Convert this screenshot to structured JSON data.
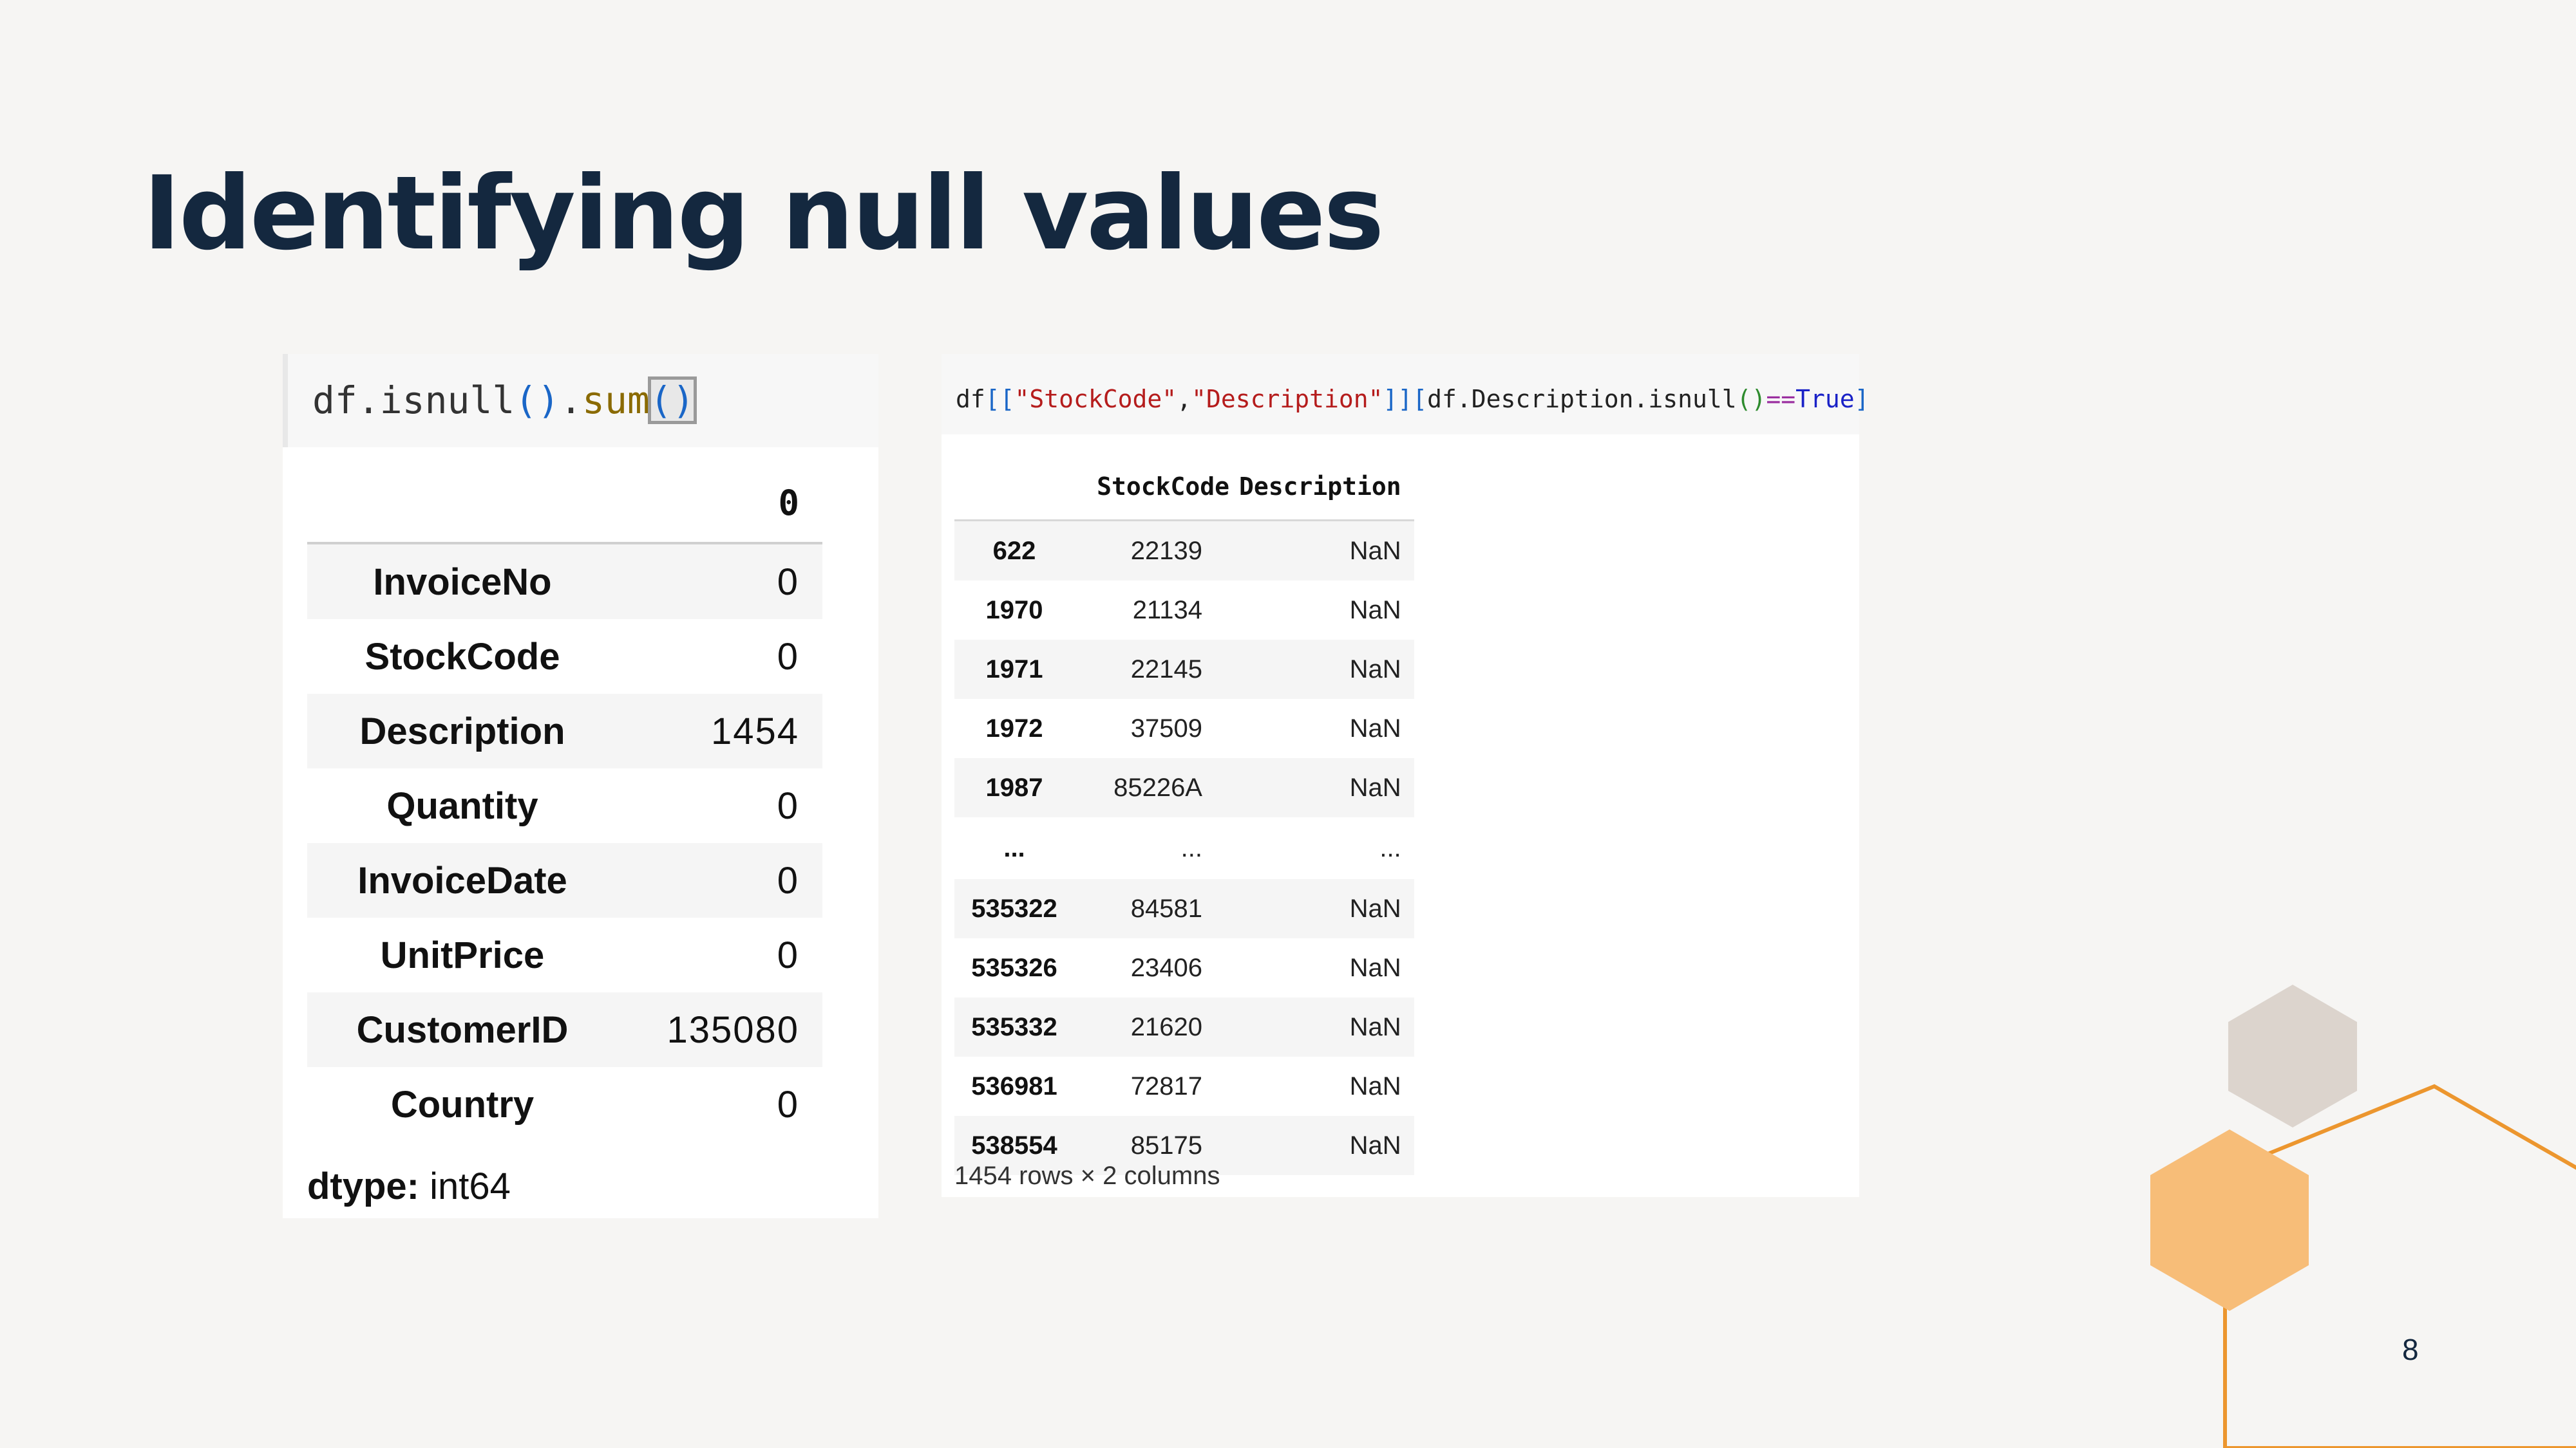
{
  "slide": {
    "title": "Identifying null values",
    "page_number": "8"
  },
  "left": {
    "code": {
      "obj": "df",
      "dot1": ".",
      "method1": "isnull",
      "open1": "(",
      "close1": ")",
      "dot2": ".",
      "method2": "sum",
      "open2": "(",
      "close2": ")"
    },
    "column_header": "0",
    "rows": [
      {
        "index": "InvoiceNo",
        "value": "0"
      },
      {
        "index": "StockCode",
        "value": "0"
      },
      {
        "index": "Description",
        "value": "1454"
      },
      {
        "index": "Quantity",
        "value": "0"
      },
      {
        "index": "InvoiceDate",
        "value": "0"
      },
      {
        "index": "UnitPrice",
        "value": "0"
      },
      {
        "index": "CustomerID",
        "value": "135080"
      },
      {
        "index": "Country",
        "value": "0"
      }
    ],
    "dtype_label": "dtype:",
    "dtype_value": " int64"
  },
  "right": {
    "code": {
      "obj": "df",
      "open": "[[",
      "col1": "\"StockCode\"",
      "comma": ",",
      "col2": "\"Description\"",
      "close": "]][",
      "expr": "df.Description.isnull",
      "parens": "()",
      "op": "==",
      "kw": "True",
      "end": "]"
    },
    "headers": {
      "index": "",
      "stock": "StockCode",
      "desc": "Description"
    },
    "rows": [
      {
        "index": "622",
        "stock": "22139",
        "desc": "NaN"
      },
      {
        "index": "1970",
        "stock": "21134",
        "desc": "NaN"
      },
      {
        "index": "1971",
        "stock": "22145",
        "desc": "NaN"
      },
      {
        "index": "1972",
        "stock": "37509",
        "desc": "NaN"
      },
      {
        "index": "1987",
        "stock": "85226A",
        "desc": "NaN"
      },
      {
        "index": "...",
        "stock": "...",
        "desc": "..."
      },
      {
        "index": "535322",
        "stock": "84581",
        "desc": "NaN"
      },
      {
        "index": "535326",
        "stock": "23406",
        "desc": "NaN"
      },
      {
        "index": "535332",
        "stock": "21620",
        "desc": "NaN"
      },
      {
        "index": "536981",
        "stock": "72817",
        "desc": "NaN"
      },
      {
        "index": "538554",
        "stock": "85175",
        "desc": "NaN"
      }
    ],
    "footer": "1454 rows × 2 columns"
  },
  "colors": {
    "title": "#14283f",
    "hex_gray": "#dcd4cd",
    "hex_orange": "#f7bd78",
    "outline_orange": "#ec962e"
  }
}
